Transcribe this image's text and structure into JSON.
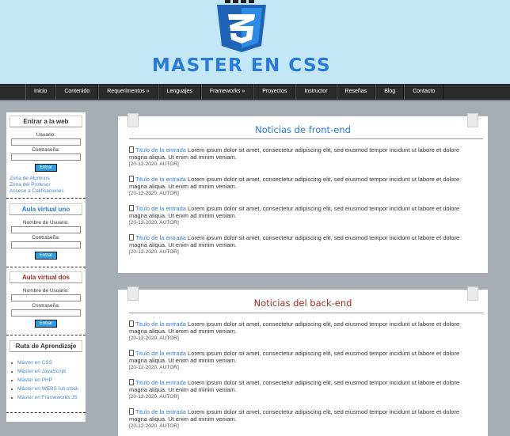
{
  "header": {
    "brand": "MASTER EN CSS",
    "logo_icon": "css3-shield-icon",
    "colors": {
      "brand_blue": "#2a7ad8",
      "header_bg": "#c4e7f7",
      "nav_bg": "#2b2b2b",
      "page_bg": "#a8adb4"
    }
  },
  "nav": {
    "items": [
      {
        "label": "Inicio"
      },
      {
        "label": "Contenido"
      },
      {
        "label": "Requerimentos »"
      },
      {
        "label": "Lenguajes"
      },
      {
        "label": "Frameworks »"
      },
      {
        "label": "Proyectos"
      },
      {
        "label": "Instructor"
      },
      {
        "label": "Reseñas"
      },
      {
        "label": "Blog"
      },
      {
        "label": "Contacto"
      }
    ]
  },
  "sidebar": {
    "login": {
      "title": "Entrar a la web",
      "user_label": "Usuario:",
      "pass_label": "Contraseña:",
      "button": "Entrar",
      "links": [
        "Zona de Alumnos",
        "Zona del Profesor",
        "Acceso a Calificaciones"
      ]
    },
    "aula_uno": {
      "title": "Aula virtual uno",
      "user_label": "Nombre de Usuario:",
      "pass_label": "Contraseña:",
      "button": "Entrar"
    },
    "aula_dos": {
      "title": "Aula virtual dos",
      "user_label": "Nombre de Usuario:",
      "pass_label": "Contraseña:",
      "button": "Entrar"
    },
    "ruta": {
      "title": "Ruta de Aprendizaje",
      "items": [
        "Máster en CSS",
        "Máster en JavaScript",
        "Máster en PHP",
        "Máster en WEBS full-stack",
        "Máster en Frameworks JS"
      ]
    }
  },
  "main": {
    "front": {
      "title": "Noticias de front-end",
      "entries": [
        {
          "link": "Titulo de la entrada",
          "text": " Lorem ipsum dolor sit amet, consectetur adipiscing elit, sed eiusmod tempor incidunt ut labore et dolore magna aliqua. Ut enim ad minim veniam.",
          "meta": "[20-12-2020. AUTOR]"
        },
        {
          "link": "Titulo de la entrada",
          "text": " Lorem ipsum dolor sit amet, consectetur adipiscing elit, sed eiusmod tempor incidunt ut labore et dolore magna aliqua. Ut enim ad minim veniam.",
          "meta": "[20-12-2020. AUTOR]"
        },
        {
          "link": "Titulo de la entrada",
          "text": " Lorem ipsum dolor sit amet, consectetur adipiscing elit, sed eiusmod tempor incidunt ut labore et dolore magna aliqua. Ut enim ad minim veniam.",
          "meta": "[20-12-2020. AUTOR]"
        },
        {
          "link": "Titulo de la entrada",
          "text": " Lorem ipsum dolor sit amet, consectetur adipiscing elit, sed eiusmod tempor incidunt ut labore et dolore magna aliqua. Ut enim ad minim veniam.",
          "meta": "[20-12-2020. AUTOR]"
        }
      ]
    },
    "back": {
      "title": "Noticias del back-end",
      "entries": [
        {
          "link": "Titulo de la entrada",
          "text": " Lorem ipsum dolor sit amet, consectetur adipiscing elit, sed eiusmod tempor incidunt ut labore et dolore magna aliqua. Ut enim ad minim veniam.",
          "meta": "[20-12-2020. AUTOR]"
        },
        {
          "link": "Titulo de la entrada",
          "text": " Lorem ipsum dolor sit amet, consectetur adipiscing elit, sed eiusmod tempor incidunt ut labore et dolore magna aliqua. Ut enim ad minim veniam.",
          "meta": "[20-12-2020. AUTOR]"
        },
        {
          "link": "Titulo de la entrada",
          "text": " Lorem ipsum dolor sit amet, consectetur adipiscing elit, sed eiusmod tempor incidunt ut labore et dolore magna aliqua. Ut enim ad minim veniam.",
          "meta": "[20-12-2020. AUTOR]"
        },
        {
          "link": "Titulo de la entrada",
          "text": " Lorem ipsum dolor sit amet, consectetur adipiscing elit, sed eiusmod tempor incidunt ut labore et dolore magna aliqua. Ut enim ad minim veniam.",
          "meta": "[20-12-2020. AUTOR]"
        }
      ]
    }
  }
}
